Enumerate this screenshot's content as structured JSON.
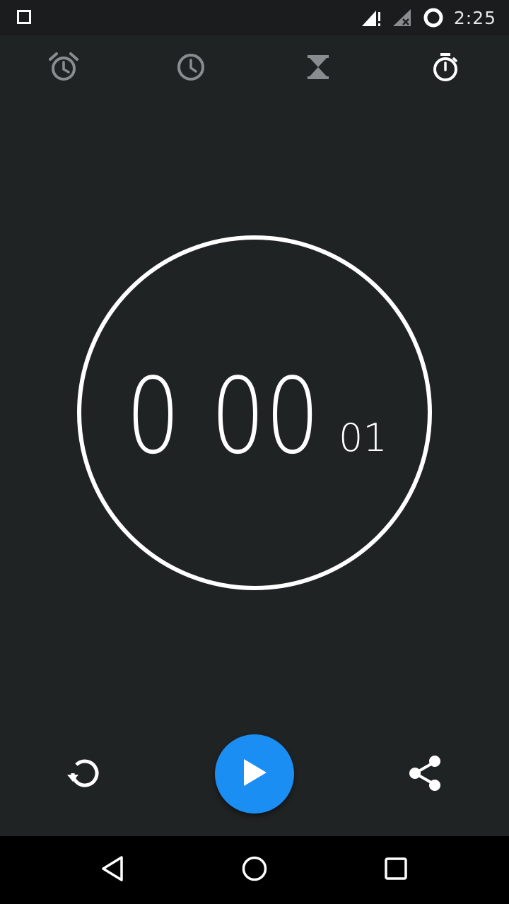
{
  "status_bar": {
    "time": "2:25",
    "icons": [
      "notification-square-icon",
      "signal-alert-icon",
      "signal-no-sim-icon",
      "sync-circle-icon"
    ]
  },
  "tabs": [
    {
      "name": "alarm",
      "icon": "alarm-clock-icon",
      "active": false
    },
    {
      "name": "clock",
      "icon": "clock-icon",
      "active": false
    },
    {
      "name": "timer",
      "icon": "hourglass-icon",
      "active": false
    },
    {
      "name": "stopwatch",
      "icon": "stopwatch-icon",
      "active": true
    }
  ],
  "stopwatch": {
    "minutes": "0",
    "seconds": "00",
    "hundredths": "01"
  },
  "controls": {
    "reset_icon": "reset-icon",
    "play_icon": "play-icon",
    "share_icon": "share-icon"
  },
  "nav": {
    "back_icon": "back-triangle-icon",
    "home_icon": "home-circle-icon",
    "recents_icon": "recents-square-icon"
  },
  "colors": {
    "background": "#202324",
    "accent": "#1b8ef4",
    "inactive_icon": "#8a8d8f",
    "active_icon": "#ffffff"
  }
}
